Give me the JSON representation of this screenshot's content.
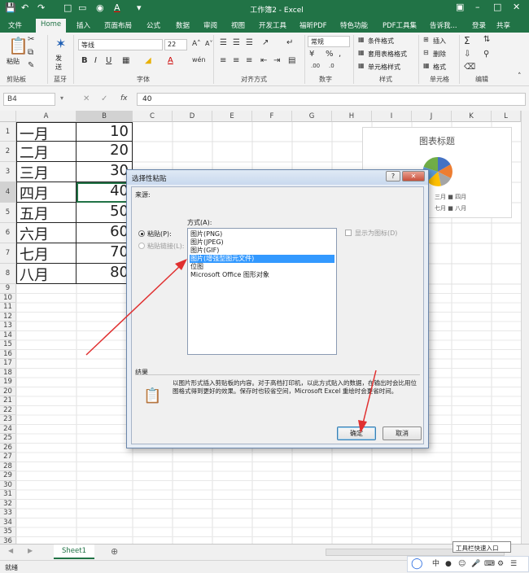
{
  "app": {
    "title": "工作簿2 - Excel",
    "login": "登录",
    "share": "共享",
    "tell_me": "告诉我..."
  },
  "tabs": [
    "文件",
    "Home",
    "插入",
    "页面布局",
    "公式",
    "数据",
    "审阅",
    "视图",
    "开发工具",
    "福昕PDF",
    "特色功能",
    "PDF工具集"
  ],
  "ribbon": {
    "paste": "粘贴",
    "send": "发送",
    "font_name": "等线",
    "font_size": "22",
    "number_format": "常规",
    "conditional": "条件格式",
    "table_format": "套用表格格式",
    "cell_style": "单元格样式",
    "insert": "插入",
    "delete": "删除",
    "format": "格式",
    "groups": {
      "clipboard": "剪贴板",
      "bluetooth": "蓝牙",
      "font": "字体",
      "alignment": "对齐方式",
      "number": "数字",
      "styles": "样式",
      "cells": "单元格",
      "editing": "编辑"
    }
  },
  "formula": {
    "cell": "B4",
    "value": "40"
  },
  "columns": [
    "A",
    "B",
    "C",
    "D",
    "E",
    "F",
    "G",
    "H",
    "I",
    "J",
    "K",
    "L"
  ],
  "rows": [
    {
      "a": "一月",
      "b": "10"
    },
    {
      "a": "二月",
      "b": "20"
    },
    {
      "a": "三月",
      "b": "30"
    },
    {
      "a": "四月",
      "b": "40"
    },
    {
      "a": "五月",
      "b": "50"
    },
    {
      "a": "六月",
      "b": "60"
    },
    {
      "a": "七月",
      "b": "70"
    },
    {
      "a": "八月",
      "b": "80"
    }
  ],
  "chart": {
    "title": "图表标题",
    "legend_row1": "三月 ■ 四月",
    "legend_row2": "七月 ■ 八月"
  },
  "dialog": {
    "title": "选择性粘贴",
    "source_label": "来源:",
    "method_label": "方式(A):",
    "paste_option": "粘贴(P):",
    "paste_link_option": "粘贴链接(L):",
    "show_icon": "显示为图标(D)",
    "list": [
      "图片(PNG)",
      "图片(JPEG)",
      "图片(GIF)",
      "图片(增强型图元文件)",
      "位图",
      "Microsoft Office 图形对象"
    ],
    "result_label": "结果",
    "result_text": "以图片形式插入剪贴板的内容。对于高档打印机，以此方式贴入的数据，在输出时会比用位图格式得到更好的效果。保存时也较省空间，Microsoft Excel 重绘时会更省时间。",
    "ok": "确定",
    "cancel": "取消",
    "help": "?"
  },
  "sheet": {
    "tab": "Sheet1",
    "status": "就绪",
    "ime_popup": "工具栏快速入口"
  },
  "colors": {
    "excel_green": "#217346",
    "selection_blue": "#3399ff",
    "arrow_red": "#e03030"
  }
}
